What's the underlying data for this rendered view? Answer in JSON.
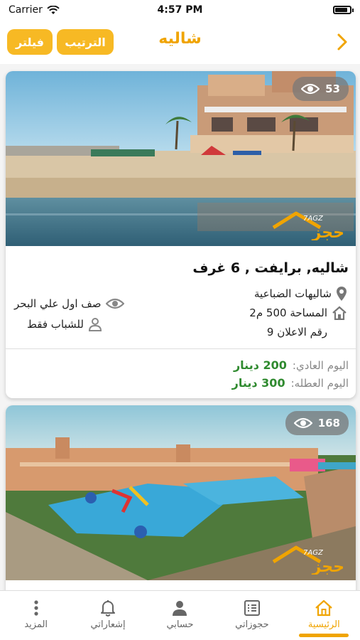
{
  "status": {
    "carrier": "Carrier",
    "time": "4:57 PM"
  },
  "nav": {
    "title": "شاليه",
    "sort_label": "الترتيب",
    "filter_label": "فيلتر"
  },
  "listings": [
    {
      "views": "53",
      "title": "شاليه, برايفت , 6 غرف",
      "location": "شاليهات الضباعية",
      "area": "المساحة 500 م2",
      "ad_number": "رقم الاعلان  9",
      "sea": "صف اول علي البحر",
      "youth": "للشباب فقط",
      "weekday_label": "اليوم العادي:",
      "weekday_price": "200 دينار",
      "holiday_label": "اليوم العطله:",
      "holiday_price": "300 دينار"
    },
    {
      "views": "168"
    }
  ],
  "logo": {
    "top": "7AGZ",
    "main": "حجز"
  },
  "tabs": [
    {
      "label": "الرئيسية",
      "icon": "home-icon",
      "active": true
    },
    {
      "label": "حجوزاتي",
      "icon": "list-icon"
    },
    {
      "label": "حسابي",
      "icon": "user-icon"
    },
    {
      "label": "إشعاراتي",
      "icon": "bell-icon"
    },
    {
      "label": "المزيد",
      "icon": "more-icon"
    }
  ],
  "colors": {
    "accent": "#f7b924",
    "price": "#2f8a2f"
  }
}
